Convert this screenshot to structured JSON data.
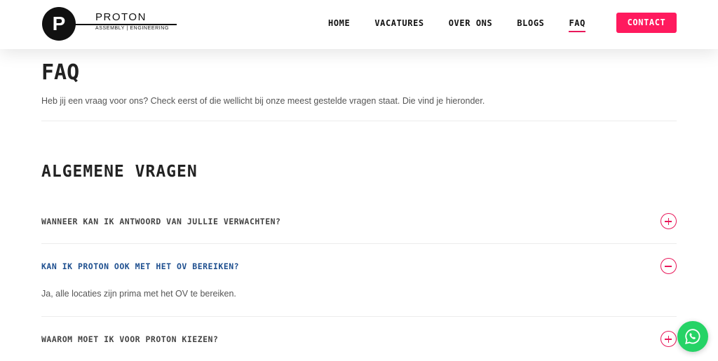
{
  "brand": {
    "logo_letter": "P",
    "name": "PROTON",
    "tagline": "ASSEMBLY | ENGINEERING"
  },
  "nav": {
    "items": [
      {
        "label": "HOME",
        "active": false
      },
      {
        "label": "VACATURES",
        "active": false
      },
      {
        "label": "OVER ONS",
        "active": false
      },
      {
        "label": "BLOGS",
        "active": false
      },
      {
        "label": "FAQ",
        "active": true
      }
    ],
    "contact_label": "CONTACT"
  },
  "page": {
    "title": "FAQ",
    "intro": "Heb jij een vraag voor ons? Check eerst of die wellicht bij onze meest gestelde vragen staat. Die vind je hieronder."
  },
  "section": {
    "title": "ALGEMENE VRAGEN",
    "faqs": [
      {
        "question": "WANNEER KAN IK ANTWOORD VAN JULLIE VERWACHTEN?",
        "answer": "",
        "open": false
      },
      {
        "question": "KAN IK PROTON OOK MET HET OV BEREIKEN?",
        "answer": "Ja, alle locaties zijn prima met het OV te bereiken.",
        "open": true
      },
      {
        "question": "WAAROM MOET IK VOOR PROTON KIEZEN?",
        "answer": "",
        "open": false
      }
    ]
  },
  "icons": {
    "expand": "plus-circle-icon",
    "collapse": "minus-circle-icon",
    "chat": "whatsapp-icon"
  },
  "colors": {
    "accent": "#ff1a5e",
    "open_question": "#1e4f8f",
    "whatsapp": "#25d366"
  }
}
